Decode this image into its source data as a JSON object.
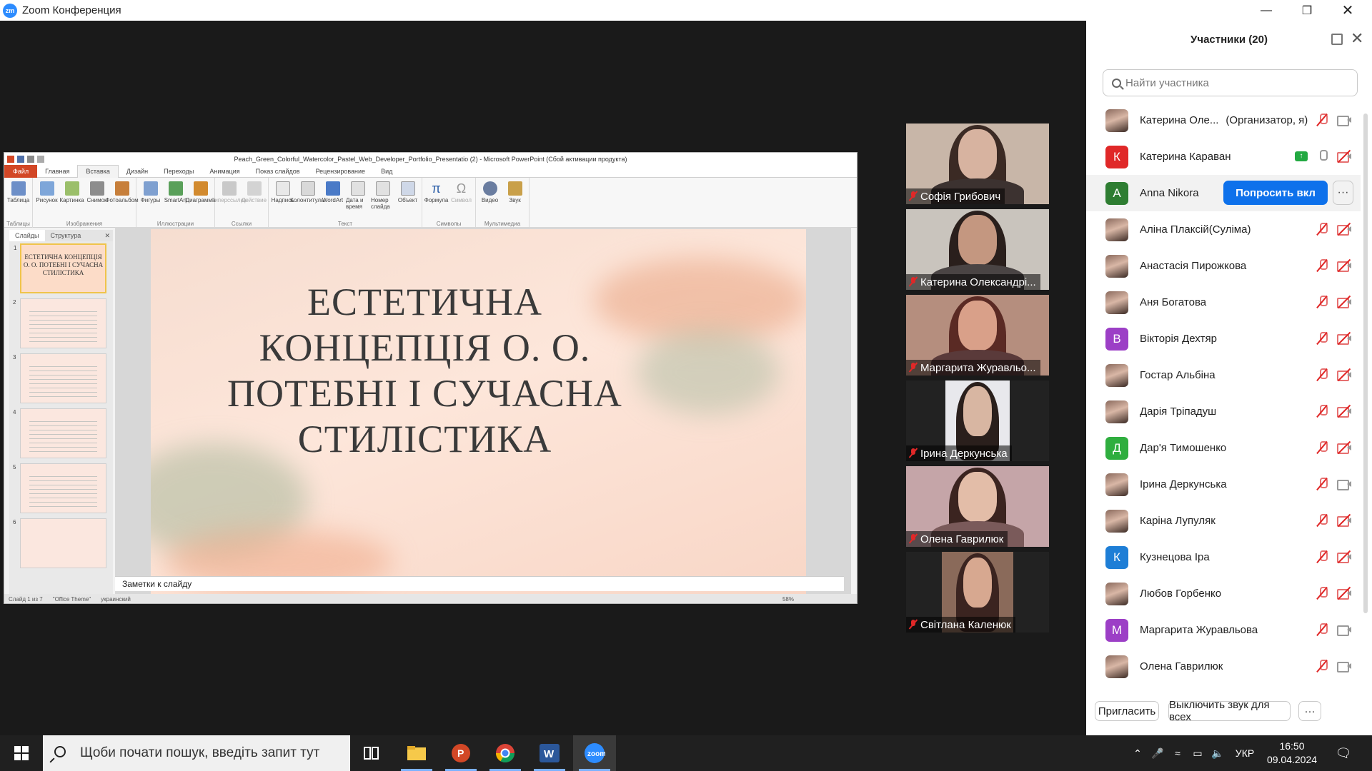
{
  "window": {
    "app_logo": "zm",
    "title": "Zoom Конференция"
  },
  "ppt": {
    "file_title": "Peach_Green_Colorful_Watercolor_Pastel_Web_Developer_Portfolio_Presentatio (2) - Microsoft PowerPoint (Сбой активации продукта)",
    "tabs": [
      "Файл",
      "Главная",
      "Вставка",
      "Дизайн",
      "Переходы",
      "Анимация",
      "Показ слайдов",
      "Рецензирование",
      "Вид"
    ],
    "active_tab": "Вставка",
    "ribbon_groups": [
      {
        "label": "Таблицы",
        "buttons": [
          "Таблица"
        ]
      },
      {
        "label": "Изображения",
        "buttons": [
          "Рисунок",
          "Картинка",
          "Снимок",
          "Фотоальбом"
        ]
      },
      {
        "label": "Иллюстрации",
        "buttons": [
          "Фигуры",
          "SmartArt",
          "Диаграмма"
        ]
      },
      {
        "label": "Ссылки",
        "buttons": [
          "Гиперссылка",
          "Действие"
        ]
      },
      {
        "label": "Текст",
        "buttons": [
          "Надпись",
          "Колонтитулы",
          "WordArt",
          "Дата и время",
          "Номер слайда",
          "Объект"
        ]
      },
      {
        "label": "Символы",
        "buttons": [
          "Формула",
          "Символ"
        ]
      },
      {
        "label": "Мультимедиа",
        "buttons": [
          "Видео",
          "Звук"
        ]
      }
    ],
    "pane_tabs": [
      "Слайды",
      "Структура"
    ],
    "thumbs": [
      {
        "num": "1",
        "text": "ЕСТЕТИЧНА КОНЦЕПЦІЯ О. О. ПОТЕБНІ І СУЧАСНА СТИЛІСТИКА"
      },
      {
        "num": "2",
        "text": ""
      },
      {
        "num": "3",
        "text": ""
      },
      {
        "num": "4",
        "text": ""
      },
      {
        "num": "5",
        "text": ""
      },
      {
        "num": "6",
        "text": ""
      }
    ],
    "slide_title_lines": [
      "ЕСТЕТИЧНА",
      "КОНЦЕПЦІЯ О. О.",
      "ПОТЕБНІ І СУЧАСНА",
      "СТИЛІСТИКА"
    ],
    "notes_placeholder": "Заметки к слайду",
    "status": {
      "slide": "Слайд 1 из 7",
      "theme": "\"Office Theme\"",
      "lang": "украинский",
      "zoom": "58%"
    }
  },
  "video_tiles": [
    {
      "name": "Софія Грибович",
      "muted": true
    },
    {
      "name": "Катерина Олександрі...",
      "muted": true
    },
    {
      "name": "Маргарита Журавльо...",
      "muted": true
    },
    {
      "name": "Ірина Деркунська",
      "muted": true
    },
    {
      "name": "Олена Гаврилюк",
      "muted": true
    },
    {
      "name": "Світлана Каленюк",
      "muted": true
    }
  ],
  "participants_panel": {
    "title": "Участники (20)",
    "search_placeholder": "Найти участника",
    "participants": [
      {
        "name": "Катерина Оле...",
        "role": "(Организатор, я)",
        "avatar": "photo",
        "letter": "",
        "color": "",
        "mic": "off",
        "cam": "on",
        "sharing": false
      },
      {
        "name": "Катерина Караван",
        "role": "",
        "avatar": "letter",
        "letter": "К",
        "color": "#e02828",
        "mic": "on",
        "cam": "off",
        "sharing": true
      },
      {
        "name": "Anna Nikora",
        "role": "",
        "avatar": "letter",
        "letter": "A",
        "color": "#2e7d32",
        "mic": "",
        "cam": "",
        "sharing": false,
        "highlight": true,
        "ask_label": "Попросить вкл",
        "more_label": "···"
      },
      {
        "name": "Аліна Плаксій(Суліма)",
        "role": "",
        "avatar": "photo",
        "letter": "",
        "color": "",
        "mic": "off",
        "cam": "off",
        "sharing": false
      },
      {
        "name": "Анастасія Пирожкова",
        "role": "",
        "avatar": "photo",
        "letter": "",
        "color": "",
        "mic": "off",
        "cam": "off",
        "sharing": false
      },
      {
        "name": "Аня Богатова",
        "role": "",
        "avatar": "photo",
        "letter": "",
        "color": "",
        "mic": "off",
        "cam": "off",
        "sharing": false
      },
      {
        "name": "Вікторія Дехтяр",
        "role": "",
        "avatar": "letter",
        "letter": "В",
        "color": "#9c3fc6",
        "mic": "off",
        "cam": "off",
        "sharing": false
      },
      {
        "name": "Гостар Альбіна",
        "role": "",
        "avatar": "photo",
        "letter": "",
        "color": "",
        "mic": "off",
        "cam": "off",
        "sharing": false
      },
      {
        "name": "Дарія Тріпадуш",
        "role": "",
        "avatar": "photo",
        "letter": "",
        "color": "",
        "mic": "off",
        "cam": "off",
        "sharing": false
      },
      {
        "name": "Дар'я Тимошенко",
        "role": "",
        "avatar": "letter",
        "letter": "Д",
        "color": "#2fae3f",
        "mic": "off",
        "cam": "off",
        "sharing": false
      },
      {
        "name": "Ірина Деркунська",
        "role": "",
        "avatar": "photo",
        "letter": "",
        "color": "",
        "mic": "off",
        "cam": "on",
        "sharing": false
      },
      {
        "name": "Каріна Лупуляк",
        "role": "",
        "avatar": "photo",
        "letter": "",
        "color": "",
        "mic": "off",
        "cam": "off",
        "sharing": false
      },
      {
        "name": "Кузнецова Іра",
        "role": "",
        "avatar": "letter",
        "letter": "К",
        "color": "#1e7ed6",
        "mic": "off",
        "cam": "off",
        "sharing": false
      },
      {
        "name": "Любов Горбенко",
        "role": "",
        "avatar": "photo",
        "letter": "",
        "color": "",
        "mic": "off",
        "cam": "off",
        "sharing": false
      },
      {
        "name": "Маргарита Журавльова",
        "role": "",
        "avatar": "letter",
        "letter": "М",
        "color": "#9c3fc6",
        "mic": "off",
        "cam": "on",
        "sharing": false
      },
      {
        "name": "Олена Гаврилюк",
        "role": "",
        "avatar": "photo",
        "letter": "",
        "color": "",
        "mic": "off",
        "cam": "on",
        "sharing": false
      }
    ],
    "invite_label": "Пригласить",
    "mute_all_label": "Выключить звук для всех",
    "more_label": "···"
  },
  "taskbar": {
    "search_text": "Щоби почати пошук, введіть запит тут",
    "lang": "УКР",
    "time": "16:50",
    "date": "09.04.2024"
  }
}
